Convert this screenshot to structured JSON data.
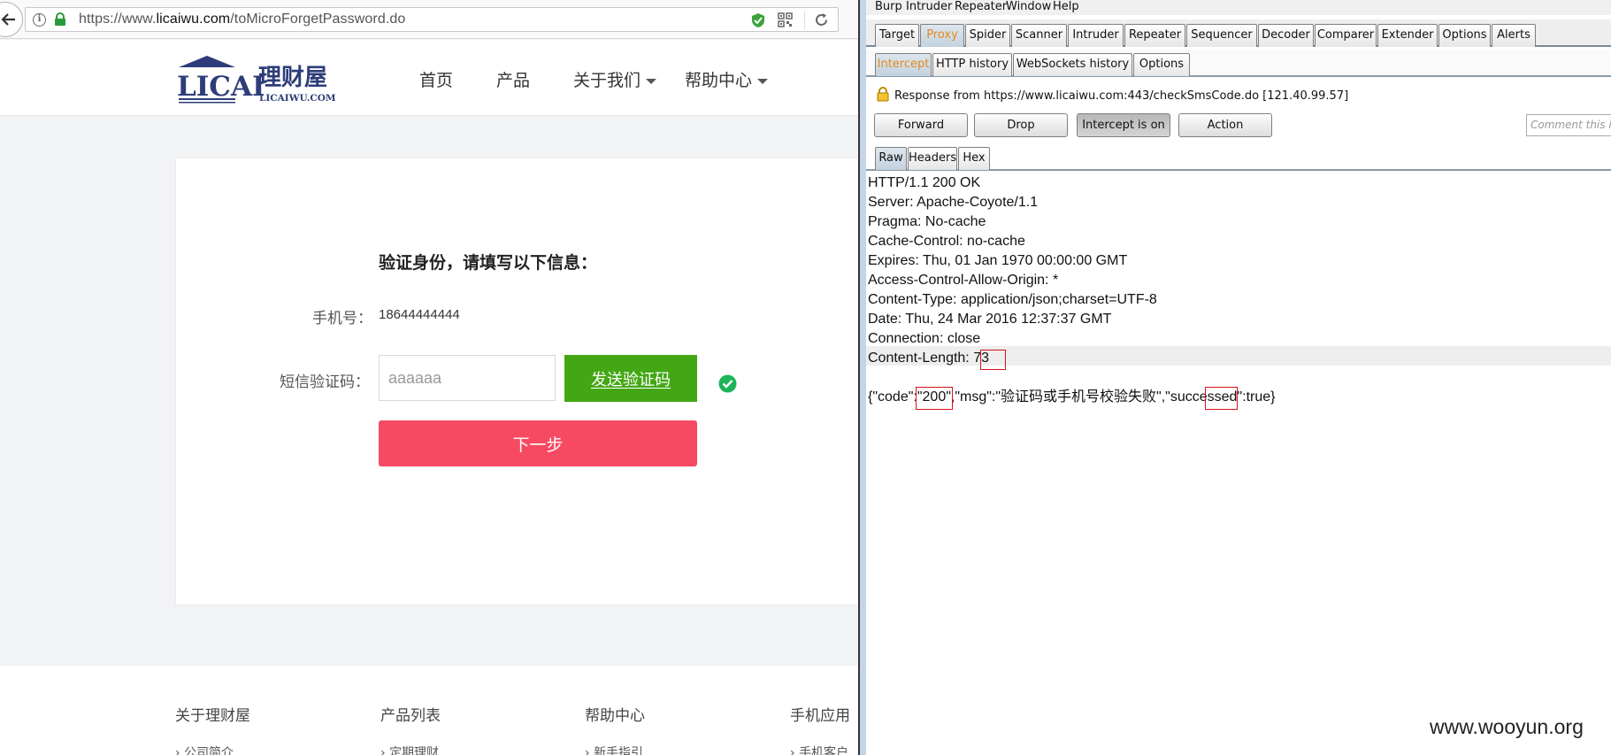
{
  "browser": {
    "url_prefix": "https://www.",
    "url_host": "licaiwu.com",
    "url_path": "/toMicroForgetPassword.do",
    "accent_green": "#43a714",
    "accent_red": "#f54a62"
  },
  "site": {
    "logo_text": "LICAI",
    "logo_cn": "理财屋",
    "logo_domain": "LICAIWU.COM",
    "nav": [
      "首页",
      "产品",
      "关于我们",
      "帮助中心"
    ]
  },
  "form": {
    "title": "验证身份，请填写以下信息：",
    "phone_label": "手机号：",
    "phone_value": "18644444444",
    "sms_label": "短信验证码：",
    "sms_value": "aaaaaa",
    "send_code": "发送验证码",
    "next": "下一步"
  },
  "footer": {
    "columns": [
      "关于理财屋",
      "产品列表",
      "帮助中心",
      "手机应用"
    ],
    "items": [
      "公司简介",
      "定期理财",
      "新手指引",
      "手机客户"
    ]
  },
  "burp": {
    "menu": [
      "Burp",
      "Intruder",
      "Repeater",
      "Window",
      "Help"
    ],
    "main_tabs": [
      "Target",
      "Proxy",
      "Spider",
      "Scanner",
      "Intruder",
      "Repeater",
      "Sequencer",
      "Decoder",
      "Comparer",
      "Extender",
      "Options",
      "Alerts"
    ],
    "active_main_tab": "Proxy",
    "proxy_tabs": [
      "Intercept",
      "HTTP history",
      "WebSockets history",
      "Options"
    ],
    "active_proxy_tab": "Intercept",
    "response_info": "Response from https://www.licaiwu.com:443/checkSmsCode.do  [121.40.99.57]",
    "buttons": [
      "Forward",
      "Drop",
      "Intercept is on",
      "Action"
    ],
    "comment_placeholder": "Comment this it",
    "view_tabs": [
      "Raw",
      "Headers",
      "Hex"
    ],
    "active_view_tab": "Raw",
    "raw_lines": [
      "HTTP/1.1 200 OK",
      "Server: Apache-Coyote/1.1",
      "Pragma: No-cache",
      "Cache-Control: no-cache",
      "Expires: Thu, 01 Jan 1970 00:00:00 GMT",
      "Access-Control-Allow-Origin: *",
      "Content-Type: application/json;charset=UTF-8",
      "Date: Thu, 24 Mar 2016 12:37:37 GMT",
      "Connection: close",
      "Content-Length: 73"
    ],
    "body_line": "{\"code\":\"200\",\"msg\":\"验证码或手机号校验失败\",\"successed\":true}",
    "highlight_color": "#d9121b",
    "active_tab_color": "#e38b1b"
  },
  "watermark": "www.wooyun.org"
}
